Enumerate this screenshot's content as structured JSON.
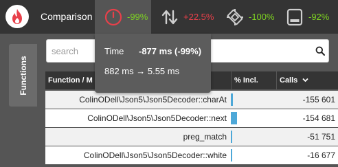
{
  "app": {
    "brand": "Comparison"
  },
  "colors": {
    "red": "#e8404a",
    "green": "#7ed321",
    "icon_grey": "#cfcfcf"
  },
  "metrics": [
    {
      "icon": "timer-icon",
      "value": "-99%",
      "color": "#7ed321",
      "active": true
    },
    {
      "icon": "up-down-arrows-icon",
      "value": "+22.5%",
      "color": "#e8404a"
    },
    {
      "icon": "cpu-chip-icon",
      "value": "-100%",
      "color": "#7ed321"
    },
    {
      "icon": "memory-icon",
      "value": "-92%",
      "color": "#7ed321"
    }
  ],
  "sidebar": {
    "tab_label": "Functions"
  },
  "search": {
    "placeholder": "search"
  },
  "table": {
    "headers": {
      "function": "Function / M",
      "incl": "% Incl.",
      "calls": "Calls"
    },
    "rows": [
      {
        "name": "ColinODell\\Json5\\Json5Decoder::charAt",
        "incl_fraction": 0.05,
        "calls": "-155 601"
      },
      {
        "name": "ColinODell\\Json5\\Json5Decoder::next",
        "incl_fraction": 0.14,
        "calls": "-154 681"
      },
      {
        "name": "preg_match",
        "incl_fraction": 0.03,
        "calls": "-51 751"
      },
      {
        "name": "ColinODell\\Json5\\Json5Decoder::white",
        "incl_fraction": 0.03,
        "calls": "-16 677"
      }
    ]
  },
  "tooltip": {
    "label": "Time",
    "diff": "-877 ms (-99%)",
    "range": "882 ms → 5.55 ms"
  }
}
